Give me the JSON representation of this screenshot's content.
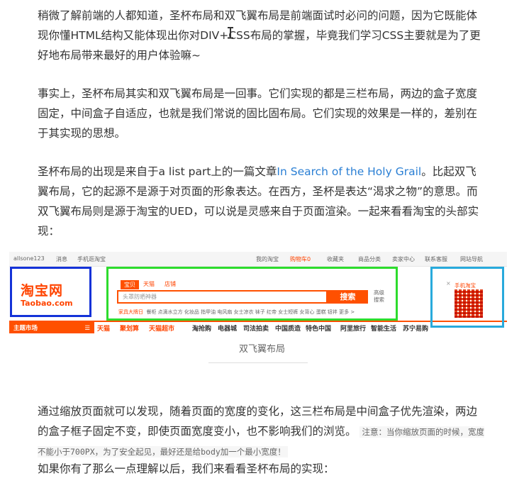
{
  "paragraphs": {
    "p1": "稍微了解前端的人都知道，圣杯布局和双飞翼布局是前端面试时必问的问题，因为它既能体现你懂HTML结构又能体现出你对DIV+CSS布局的掌握，毕竟我们学习CSS主要就是为了更好地布局带来最好的用户体验嘛~",
    "p2": "事实上，圣杯布局其实和双飞翼布局是一回事。它们实现的都是三栏布局，两边的盒子宽度固定，中间盒子自适应，也就是我们常说的固比固布局。它们实现的效果是一样的，差别在于其实现的思想。",
    "p3_before": "圣杯布局的出现是来自于a list part上的一篇文章",
    "p3_link": "In Search of the Holy Grail",
    "p3_after": "。比起双飞翼布局，它的起源不是源于对页面的形象表达。在西方，圣杯是表达“渴求之物”的意思。而双飞翼布局则是源于淘宝的UED，可以说是灵感来自于页面渲染。一起来看看淘宝的头部实现：",
    "p4": "通过缩放页面就可以发现，随着页面的宽度的变化，这三栏布局是中间盒子优先渲染，两边的盒子框子固定不变，即使页面宽度变小，也不影响我们的浏览。",
    "p4_note": "注意：当你缩放页面的时候，宽度不能小于700PX，为了安全起见，最好还是给body加一个最小宽度！",
    "p5": "如果你有了那么一点理解以后，我们来看看圣杯布局的实现："
  },
  "figure": {
    "caption": "双飞翼布局",
    "topbar": {
      "user": "allsone123",
      "msg": "消息",
      "mobile": "手机逛淘宝",
      "my": "我的淘宝",
      "cart": "购物车0",
      "fav": "收藏夹",
      "cat": "商品分类",
      "seller": "卖家中心",
      "service": "联系客服",
      "sitemap": "网站导航"
    },
    "logo_cn": "淘宝网",
    "logo_en": "Taobao.com",
    "tabs": [
      "宝贝",
      "天猫",
      "店铺"
    ],
    "search_placeholder": "头罩防晒神器",
    "search_button": "搜索",
    "advanced": "高级搜索",
    "hot_first": "家具大牌日",
    "hot_words": "餐柜  点滴水立方  化妆品  指甲油  电风扇  女士凉衣  袜子  红帝  女士短裤  女背心  蛋糕  钮袢  更多 >",
    "qr_title": "手机淘宝",
    "qr_close": "×",
    "nav_main": "主题市场",
    "nav_items": [
      "天猫",
      "聚划算",
      "天猫超市",
      "淘抢购",
      "电器城",
      "司法拍卖",
      "中国质造",
      "特色中国",
      "阿里旅行",
      "智能生活",
      "苏宁易购"
    ]
  },
  "colors": {
    "blue_box": "#1432d8",
    "green_box": "#2ddc2d",
    "cyan_box": "#28aadc",
    "taobao_orange": "#ff5000",
    "link": "#2a7fd4"
  }
}
